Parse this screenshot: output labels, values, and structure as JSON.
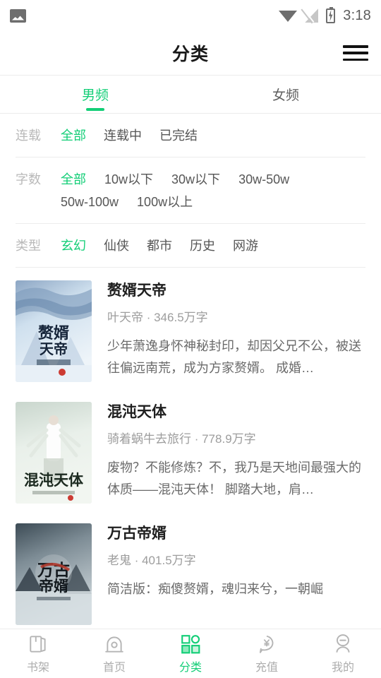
{
  "statusbar": {
    "image_icon": "image-icon",
    "wifi_icon": "wifi-icon",
    "signal_icon": "signal-off-icon",
    "battery_icon": "battery-charging-icon",
    "time": "3:18"
  },
  "header": {
    "title": "分类",
    "menu_icon": "hamburger-menu-icon"
  },
  "channel_tabs": [
    {
      "label": "男频",
      "active": true
    },
    {
      "label": "女频",
      "active": false
    }
  ],
  "filters": [
    {
      "label": "连载",
      "options": [
        {
          "label": "全部",
          "active": true
        },
        {
          "label": "连载中",
          "active": false
        },
        {
          "label": "已完结",
          "active": false
        }
      ]
    },
    {
      "label": "字数",
      "options": [
        {
          "label": "全部",
          "active": true
        },
        {
          "label": "10w以下",
          "active": false
        },
        {
          "label": "30w以下",
          "active": false
        },
        {
          "label": "30w-50w",
          "active": false
        },
        {
          "label": "50w-100w",
          "active": false
        },
        {
          "label": "100w以上",
          "active": false
        }
      ]
    },
    {
      "label": "类型",
      "options": [
        {
          "label": "玄幻",
          "active": true
        },
        {
          "label": "仙侠",
          "active": false
        },
        {
          "label": "都市",
          "active": false
        },
        {
          "label": "历史",
          "active": false
        },
        {
          "label": "网游",
          "active": false
        }
      ]
    }
  ],
  "books": [
    {
      "title": "赘婿天帝",
      "author": "叶天帝",
      "words": "346.5万字",
      "meta": "叶天帝 · 346.5万字",
      "desc": "少年萧逸身怀神秘封印，却因父兄不公，被送往偏远南荒，成为方家赘婿。 成婚…",
      "cover_title": "赘婿天帝"
    },
    {
      "title": "混沌天体",
      "author": "骑着蜗牛去旅行",
      "words": "778.9万字",
      "meta": "骑着蜗牛去旅行 · 778.9万字",
      "desc": "废物？不能修炼？不，我乃是天地间最强大的体质——混沌天体！ 脚踏大地，肩…",
      "cover_title": "混沌天体"
    },
    {
      "title": "万古帝婿",
      "author": "老鬼",
      "words": "401.5万字",
      "meta": "老鬼 · 401.5万字",
      "desc": "简洁版：痴傻赘婿，魂归来兮，一朝崛",
      "cover_title": "万古帝婿"
    }
  ],
  "bottom_nav": [
    {
      "label": "书架",
      "icon": "bookshelf-icon",
      "active": false
    },
    {
      "label": "首页",
      "icon": "home-icon",
      "active": false
    },
    {
      "label": "分类",
      "icon": "category-grid-icon",
      "active": true
    },
    {
      "label": "充值",
      "icon": "recharge-yen-icon",
      "active": false
    },
    {
      "label": "我的",
      "icon": "profile-person-icon",
      "active": false
    }
  ],
  "colors": {
    "accent": "#13ce77",
    "text_primary": "#1f1f1f",
    "text_secondary": "#6a6a6a",
    "text_muted": "#9d9d9d",
    "divider": "#ececec"
  }
}
